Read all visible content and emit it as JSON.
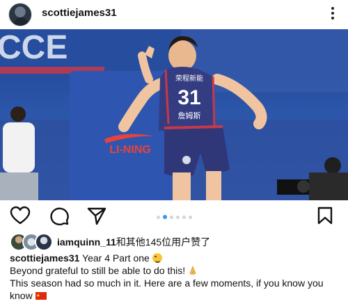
{
  "post": {
    "username": "scottiejames31",
    "photo": {
      "arena_banner_text": "CCE",
      "jersey_sponsor": "荣程新能",
      "jersey_number": "31",
      "jersey_name": "詹姆斯",
      "brand_text": "LI-NING"
    },
    "carousel": {
      "total": 6,
      "active": 1
    },
    "actions": [
      "like-icon",
      "comment-icon",
      "share-icon",
      "save-icon"
    ],
    "likes": {
      "user": "iamquinn_11",
      "rest": "和其他145位用户赞了"
    },
    "caption": {
      "user": "scottiejames31",
      "line1": " Year 4 Part one ",
      "line2": "Beyond grateful to still be able to do this! ",
      "line3": "This season had so much in it. Here are a few moments, if you know you know "
    }
  }
}
